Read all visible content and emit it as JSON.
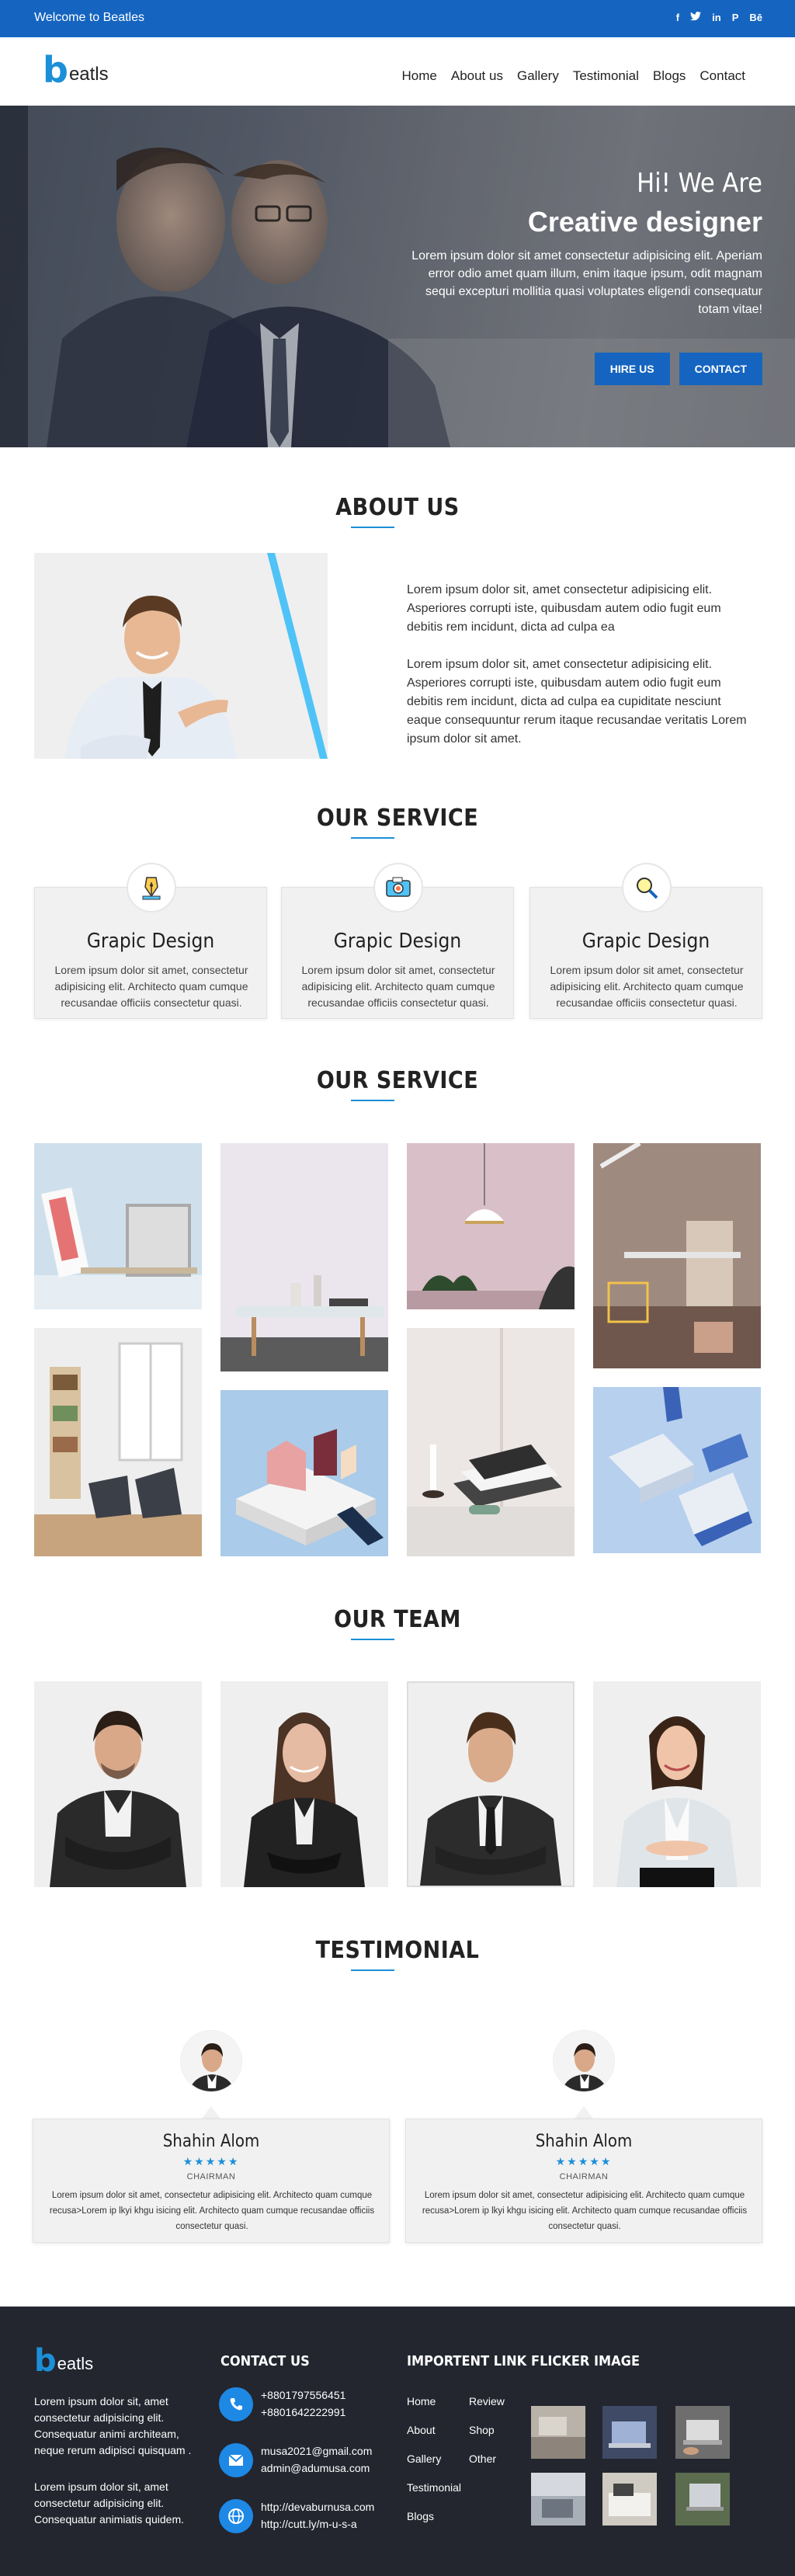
{
  "topbar": {
    "welcome": "Welcome to Beatles",
    "social_icons": [
      "facebook-icon",
      "twitter-icon",
      "linkedin-icon",
      "pinterest-icon",
      "behance-icon"
    ]
  },
  "logo": {
    "b": "b",
    "rest": "eatls"
  },
  "nav": [
    "Home",
    "About us",
    "Gallery",
    "Testimonial",
    "Blogs",
    "Contact"
  ],
  "hero": {
    "line1": "Hi! We Are",
    "line2": "Creative designer",
    "description": "Lorem ipsum dolor sit amet consectetur adipisicing elit. Aperiam error odio amet quam illum, enim itaque ipsum, odit magnam sequi excepturi mollitia quasi voluptates eligendi consequatur totam vitae!",
    "hire_button": "HIRE US",
    "contact_button": "CONTACT"
  },
  "about": {
    "title": "ABOUT US",
    "p1": "Lorem ipsum dolor sit, amet consectetur adipisicing elit. Asperiores corrupti iste, quibusdam autem odio fugit eum debitis rem incidunt, dicta ad culpa ea",
    "p2": "Lorem ipsum dolor sit, amet consectetur adipisicing elit. Asperiores corrupti iste, quibusdam autem odio fugit eum debitis rem incidunt, dicta ad culpa ea cupiditate nesciunt eaque consequuntur rerum itaque recusandae veritatis Lorem ipsum dolor sit amet."
  },
  "service": {
    "title": "OUR SERVICE",
    "cards": [
      {
        "icon": "pen-nib-icon",
        "title": "Grapic Design",
        "text": "Lorem ipsum dolor sit amet, consectetur adipisicing elit. Architecto quam cumque recusandae officiis consectetur quasi."
      },
      {
        "icon": "camera-icon",
        "title": "Grapic Design",
        "text": "Lorem ipsum dolor sit amet, consectetur adipisicing elit. Architecto quam cumque recusandae officiis consectetur quasi."
      },
      {
        "icon": "magnifier-icon",
        "title": "Grapic Design",
        "text": "Lorem ipsum dolor sit amet, consectetur adipisicing elit. Architecto quam cumque recusandae officiis consectetur quasi."
      }
    ]
  },
  "gallery": {
    "title": "OUR SERVICE"
  },
  "team": {
    "title": "OUR TEAM"
  },
  "testimonial": {
    "title": "TESTIMONIAL",
    "items": [
      {
        "name": "Shahin Alom",
        "stars": "★★★★★",
        "role": "CHAIRMAN",
        "text": "Lorem ipsum dolor sit amet, consectetur adipisicing elit. Architecto quam cumque recusa>Lorem ip lkyi khgu isicing elit. Architecto quam cumque recusandae officiis consectetur quasi."
      },
      {
        "name": "Shahin Alom",
        "stars": "★★★★★",
        "role": "CHAIRMAN",
        "text": "Lorem ipsum dolor sit amet, consectetur adipisicing elit. Architecto quam cumque recusa>Lorem ip lkyi khgu isicing elit. Architecto quam cumque recusandae officiis consectetur quasi."
      }
    ]
  },
  "footer": {
    "about1": "Lorem ipsum dolor sit, amet consectetur adipisicing elit. Consequatur animi architeam, neque rerum adipisci quisquam .",
    "about2": "Lorem ipsum dolor sit, amet consectetur adipisicing elit. Consequatur animiatis quidem.",
    "contact_title": "CONTACT US",
    "phone1": "+8801797556451",
    "phone2": "+8801642222991",
    "email1": "musa2021@gmail.com",
    "email2": "admin@adumusa.com",
    "web1": "http://devaburnusa.com",
    "web2": "http://cutt.ly/m-u-s-a",
    "links_title": "IMPORTENT LINK",
    "links_col1": [
      "Home",
      "About",
      "Gallery",
      "Testimonial",
      "Blogs"
    ],
    "links_col2": [
      "Review",
      "Shop",
      "Other"
    ],
    "flicker_title": "FLICKER IMAGE"
  },
  "colors": {
    "primary": "#1565c0",
    "accent": "#1b8fd8",
    "footer_bg": "#23262f"
  }
}
